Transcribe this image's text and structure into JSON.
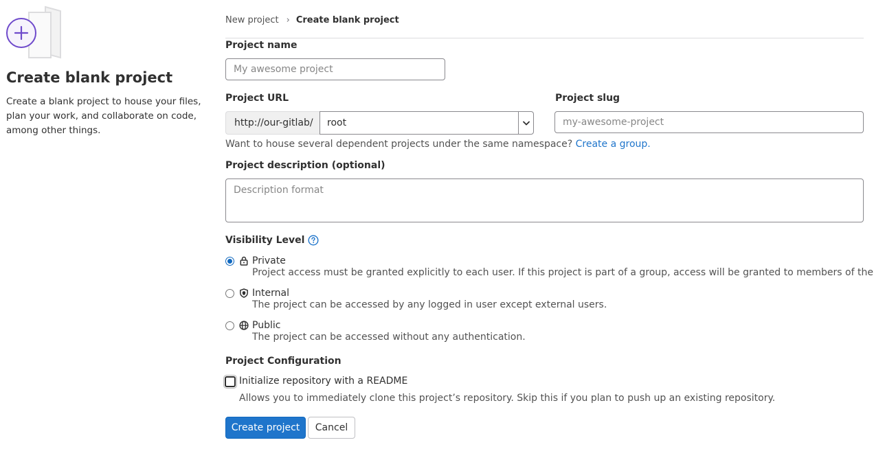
{
  "sidebar": {
    "title": "Create blank project",
    "description": "Create a blank project to house your files, plan your work, and collaborate on code, among other things."
  },
  "breadcrumb": {
    "items": [
      "New project",
      "Create blank project"
    ],
    "separator": "›"
  },
  "form": {
    "project_name": {
      "label": "Project name",
      "placeholder": "My awesome project",
      "value": ""
    },
    "project_url": {
      "label": "Project URL",
      "prefix": "http://our-gitlab/",
      "namespace": "root"
    },
    "project_slug": {
      "label": "Project slug",
      "placeholder": "my-awesome-project",
      "value": ""
    },
    "namespace_help": {
      "text": "Want to house several dependent projects under the same namespace?",
      "link": "Create a group."
    },
    "description": {
      "label": "Project description (optional)",
      "placeholder": "Description format"
    },
    "visibility": {
      "label": "Visibility Level",
      "help_icon": "question-circle-icon",
      "selected": "Private",
      "options": [
        {
          "title": "Private",
          "icon": "lock-icon",
          "desc": "Project access must be granted explicitly to each user. If this project is part of a group, access will be granted to members of the group."
        },
        {
          "title": "Internal",
          "icon": "shield-icon",
          "desc": "The project can be accessed by any logged in user except external users."
        },
        {
          "title": "Public",
          "icon": "globe-icon",
          "desc": "The project can be accessed without any authentication."
        }
      ]
    },
    "configuration": {
      "label": "Project Configuration",
      "readme_label": "Initialize repository with a README",
      "readme_checked": false,
      "readme_help": "Allows you to immediately clone this project’s repository. Skip this if you plan to push up an existing repository."
    },
    "actions": {
      "create": "Create project",
      "cancel": "Cancel"
    }
  },
  "colors": {
    "primary": "#1f75cb",
    "accent_purple": "#6e49cb",
    "text": "#303030",
    "link": "#1f75cb"
  }
}
